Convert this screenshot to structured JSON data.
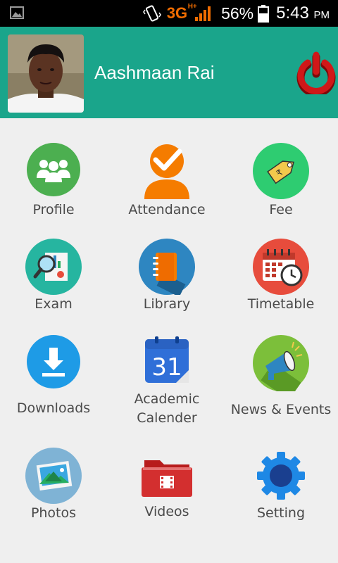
{
  "status_bar": {
    "network": "3G",
    "network_plus": "H+",
    "battery_percent": "56%",
    "time": "5:43",
    "time_suffix": "PM"
  },
  "header": {
    "user_name": "Aashmaan Rai",
    "bg_color": "#1aa58b"
  },
  "menu": [
    {
      "label": "Profile",
      "icon": "group-icon"
    },
    {
      "label": "Attendance",
      "icon": "checkmark-person-icon"
    },
    {
      "label": "Fee",
      "icon": "price-tag-icon"
    },
    {
      "label": "Exam",
      "icon": "magnifier-report-icon"
    },
    {
      "label": "Library",
      "icon": "notebook-icon"
    },
    {
      "label": "Timetable",
      "icon": "calendar-clock-icon"
    },
    {
      "label": "Downloads",
      "icon": "download-icon"
    },
    {
      "label": "Academic",
      "label2": "Calender",
      "icon": "calendar-31-icon"
    },
    {
      "label": "News & Events",
      "icon": "megaphone-icon"
    },
    {
      "label": "Photos",
      "icon": "photos-icon"
    },
    {
      "label": "Videos",
      "icon": "video-folder-icon"
    },
    {
      "label": "Setting",
      "icon": "gear-icon"
    }
  ]
}
